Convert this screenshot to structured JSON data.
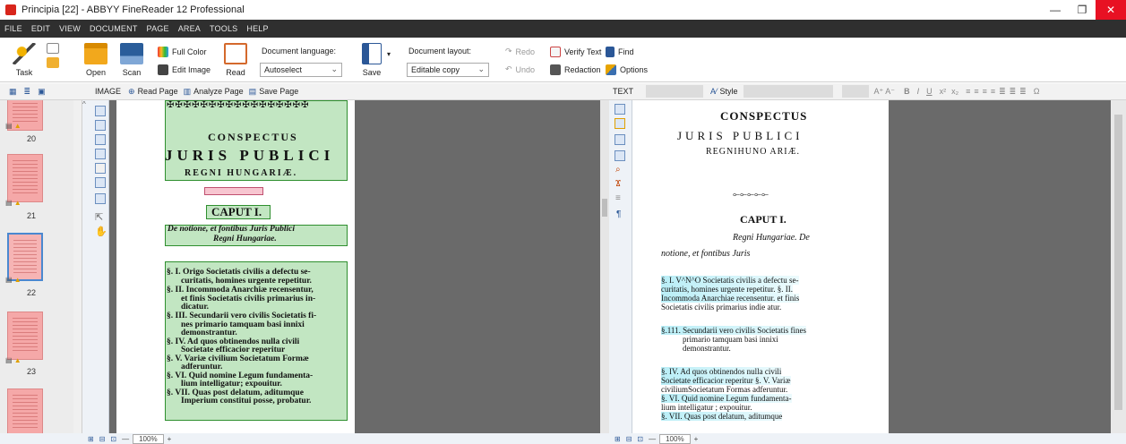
{
  "window": {
    "title": "Principia [22] - ABBYY FineReader 12 Professional"
  },
  "menu": [
    "FILE",
    "EDIT",
    "VIEW",
    "DOCUMENT",
    "PAGE",
    "AREA",
    "TOOLS",
    "HELP"
  ],
  "toolbar": {
    "task": "Task",
    "open": "Open",
    "scan": "Scan",
    "full_color": "Full Color",
    "edit_image": "Edit Image",
    "read": "Read",
    "doc_language_label": "Document language:",
    "doc_language_value": "Autoselect",
    "save": "Save",
    "doc_layout_label": "Document layout:",
    "doc_layout_value": "Editable copy",
    "redo": "Redo",
    "undo": "Undo",
    "verify_text": "Verify Text",
    "find": "Find",
    "redaction": "Redaction",
    "options": "Options"
  },
  "image_bar": {
    "label": "IMAGE",
    "read_page": "Read Page",
    "analyze_page": "Analyze Page",
    "save_page": "Save Page"
  },
  "text_bar": {
    "label": "TEXT",
    "style": "Style",
    "font_size_buttons": "A⁺ A⁻",
    "bold": "B",
    "italic": "I",
    "underline": "U",
    "sup": "x²",
    "sub": "x₂",
    "omega": "Ω"
  },
  "thumbnails": [
    "20",
    "21",
    "22",
    "23"
  ],
  "image_page": {
    "title1": "CONSPECTUS",
    "title2": "JURIS PUBLICI",
    "title3": "REGNI HUNGARIÆ.",
    "caput": "CAPUT I.",
    "subtitle1": "De notione, et fontibus Juris Publici",
    "subtitle2": "Regni Hungariae.",
    "lines": [
      "§. I. Origo Societatis civilis a defectu se-",
      "curitatis, homines urgente repetitur.",
      "§. II. Incommoda Anarchiæ recensentur,",
      "et finis Societatis civilis primarius in-",
      "dicatur.",
      "§. III. Secundarii vero civilis Societatis fi-",
      "nes primario tamquam basi innixi",
      "demonstrantur.",
      "§. IV. Ad quos obtinendos nulla civili",
      "Societate efficacior reperitur",
      "§. V. Variæ civilium Societatum Formæ",
      "adferuntur.",
      "§. VI. Quid nomine Legum fundamenta-",
      "lium intelligatur; expouitur.",
      "§. VII. Quas post delatum, aditumque",
      "Imperium constitui posse, probatur."
    ]
  },
  "text_page": {
    "title1": "CONSPECTUS",
    "title2": "JURIS PUBLICI",
    "title3": "REGNIHUNO ARIÆ.",
    "caput": "CAPUT I.",
    "sub1": "Regni Hungariae. De",
    "sub2": "notione, et fontibus Juris",
    "lines": [
      "§. I. V^N^O Societatis civilis a defectu se-",
      "curitatis, homines urgente repetitur. §. II.",
      "Incommoda Anarchiae recensentur. et finis",
      "Societatis civilis primarius indie atur.",
      "§.111. Secundarii vero civilis Societatis fines",
      "primario tamquam basi innixi",
      "demonstrantur.",
      "§. IV. Ad quos obtinendos nulla civili",
      "Societate efficacior reperitur §. V. Variæ",
      "civiliumSocietatum Formas adferuntur.",
      "§. VI. Quid nomine Legum fundamenta-",
      "lium intelligatur ; expouitur.",
      "§. VII. Quas post delatum, aditumque"
    ]
  },
  "zoom_left": "100%",
  "zoom_right": "100%"
}
